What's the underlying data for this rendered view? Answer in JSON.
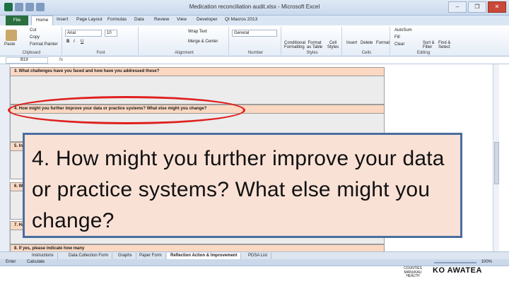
{
  "window": {
    "title": "Medication reconciliation audit.xlsx - Microsoft Excel",
    "controls": [
      "–",
      "❐",
      "✕"
    ]
  },
  "ribbon_tabs": [
    "File",
    "Home",
    "Insert",
    "Page Layout",
    "Formulas",
    "Data",
    "Review",
    "View",
    "Developer",
    "QI Macros 2013"
  ],
  "ribbon": {
    "clipboard": {
      "label": "Clipboard",
      "paste": "Paste",
      "cut": "Cut",
      "copy": "Copy",
      "format_painter": "Format Painter"
    },
    "font": {
      "label": "Font",
      "name": "Arial",
      "size": "10"
    },
    "alignment": {
      "label": "Alignment",
      "wrap": "Wrap Text",
      "merge": "Merge & Center"
    },
    "number": {
      "label": "Number",
      "format": "General"
    },
    "styles": {
      "label": "Styles",
      "conditional": "Conditional Formatting",
      "format_table": "Format as Table",
      "cell_styles": "Cell Styles"
    },
    "cells": {
      "label": "Cells",
      "insert": "Insert",
      "delete": "Delete",
      "format": "Format"
    },
    "editing": {
      "label": "Editing",
      "autosum": "AutoSum",
      "fill": "Fill",
      "clear": "Clear",
      "sort": "Sort & Filter",
      "find": "Find & Select"
    }
  },
  "formula_bar": {
    "name_box": "B19",
    "fx": "fx"
  },
  "sheet": {
    "q3": "3. What challenges have you faced and how have you addressed these?",
    "q4": "4. How might you further improve your data or practice systems?  What else might you change?",
    "q5": "5. In",
    "q6": "6. W",
    "q7": "7. Ha",
    "q8": "8. If yes, please indicate how many"
  },
  "callout": {
    "text": "4. How might you further improve your data or practice systems? What else might you change?"
  },
  "sheet_tabs": [
    "Instructions",
    "Data Collection Form",
    "Graphs",
    "Paper Form",
    "Reflection Action & Improvement",
    "PDSA List"
  ],
  "status": {
    "mode": "Enter",
    "calc": "Calculate",
    "zoom": "100%"
  },
  "logos": {
    "left": "COUNTIES MANUKAU HEALTH",
    "right": "KO AWATEA"
  },
  "colors": {
    "accent": "#2a6f3f",
    "question_fill": "#fbd8c2",
    "callout_fill": "#f9e1d6",
    "callout_border": "#4a6ea0",
    "highlight": "#e02020"
  }
}
